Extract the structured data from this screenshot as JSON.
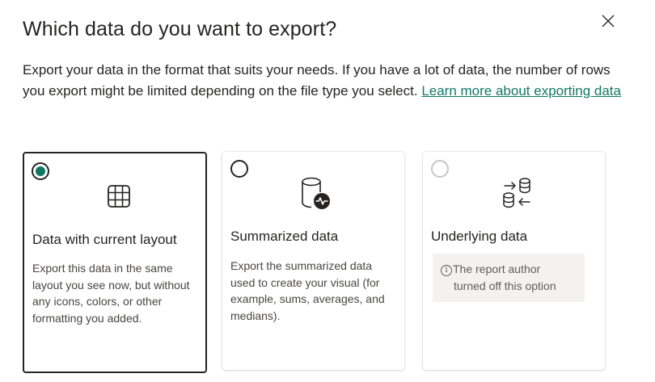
{
  "dialog": {
    "title": "Which data do you want to export?",
    "description": "Export your data in the format that suits your needs. If you have a lot of data, the number of rows you export might be limited depending on the file type you select.",
    "learn_more_link": "Learn more about exporting data",
    "close_icon": "close-icon"
  },
  "options": [
    {
      "title": "Data with current layout",
      "description": "Export this data in the same layout you see now, but without any icons, colors, or other formatting you added.",
      "icon": "table-grid-icon",
      "selected": true,
      "disabled": false
    },
    {
      "title": "Summarized data",
      "description": "Export the summarized data used to create your visual (for example, sums, averages, and medians).",
      "icon": "database-activity-icon",
      "selected": false,
      "disabled": false
    },
    {
      "title": "Underlying data",
      "disabled_note": "The report author turned off this option",
      "disabled_note_line1": "The report author",
      "disabled_note_line2": "turned off this option",
      "info_glyph": "i",
      "icon": "database-swap-icon",
      "selected": false,
      "disabled": true
    }
  ],
  "colors": {
    "accent": "#117865",
    "text": "#252423",
    "muted": "#605e5c",
    "disabled_bg": "#f3f2f1"
  }
}
